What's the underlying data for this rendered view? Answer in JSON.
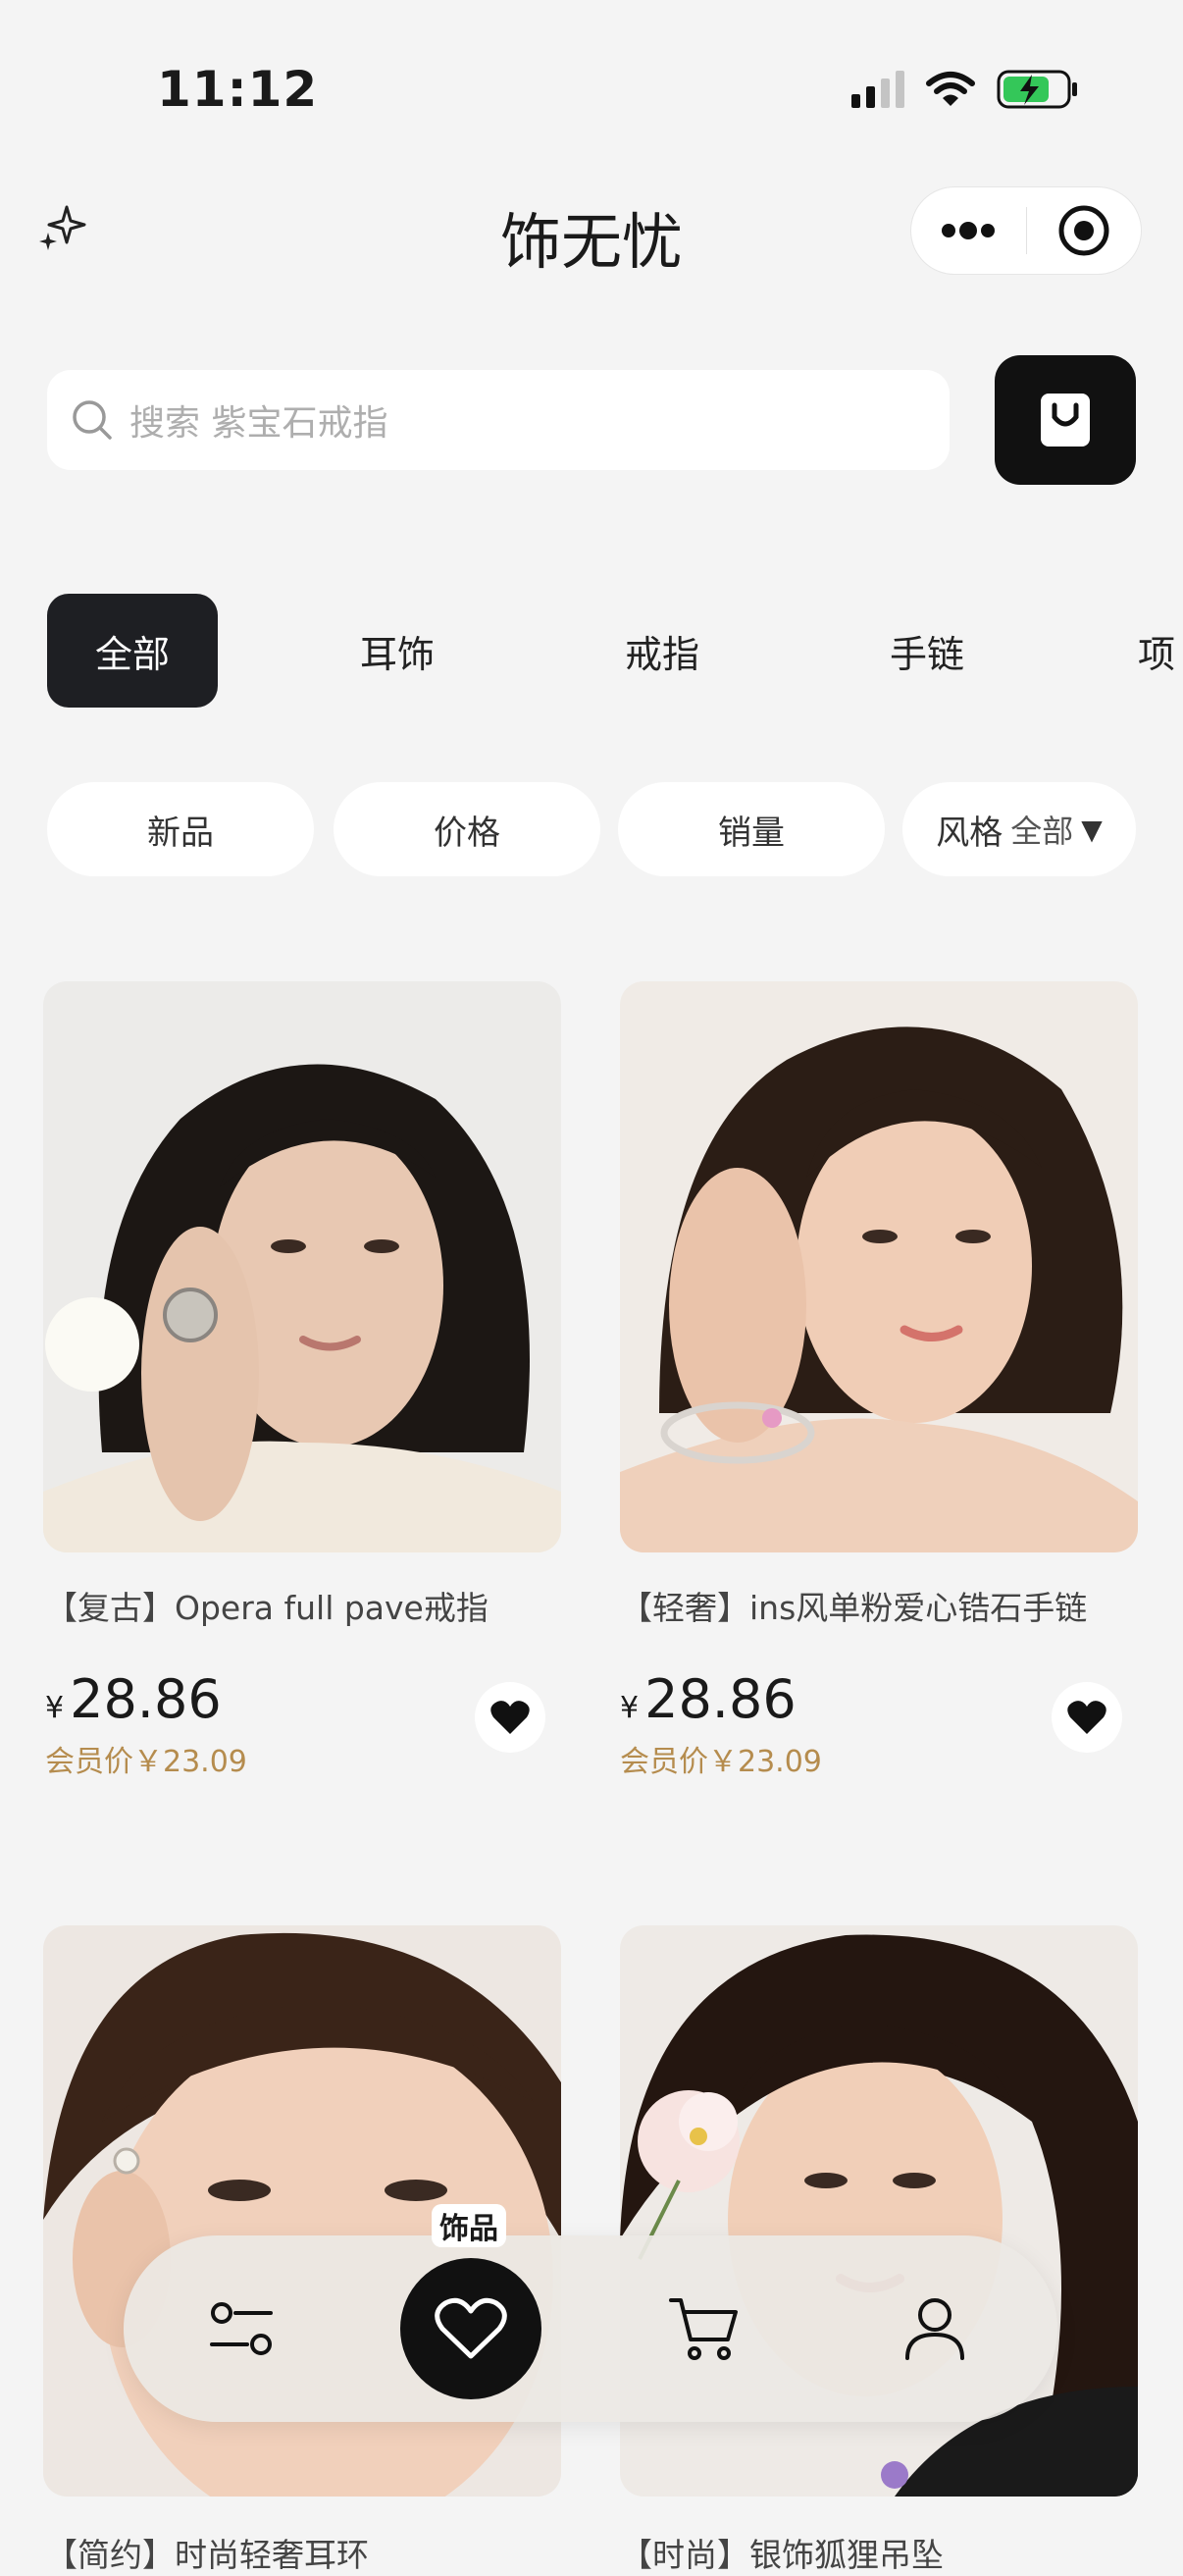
{
  "status_bar": {
    "time": "11:12"
  },
  "nav": {
    "title": "饰无忧"
  },
  "search": {
    "placeholder": "搜索 紫宝石戒指"
  },
  "categories": [
    "全部",
    "耳饰",
    "戒指",
    "手链",
    "项"
  ],
  "filters": {
    "new": "新品",
    "price": "价格",
    "sales": "销量",
    "style": "风格",
    "style_value": "全部",
    "style_arrow": "▼"
  },
  "products": [
    {
      "name": "【复古】Opera full pave戒指",
      "currency": "¥",
      "price": "28.86",
      "member_price": "会员价￥23.09"
    },
    {
      "name": "【轻奢】ins风单粉爱心锆石手链",
      "currency": "¥",
      "price": "28.86",
      "member_price": "会员价￥23.09"
    },
    {
      "name": "【简约】时尚轻奢耳环"
    },
    {
      "name": "【时尚】银饰狐狸吊坠"
    }
  ],
  "dock": {
    "center_label": "饰品"
  },
  "icons": {
    "sparkle": "sparkle-icon",
    "more": "more-dots-icon",
    "target": "target-icon",
    "search": "search-icon",
    "bag": "shopping-bag-icon",
    "heart": "heart-icon",
    "filter": "filter-sliders-icon",
    "cart": "cart-icon",
    "user": "user-icon"
  },
  "colors": {
    "accent": "#111111",
    "member_price": "#b58c4e",
    "background": "#f4f4f4"
  }
}
